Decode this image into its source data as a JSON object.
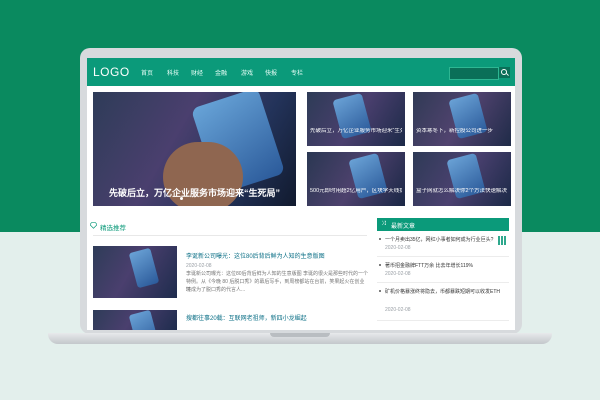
{
  "header": {
    "logo": "LOGO",
    "nav": [
      "首页",
      "科技",
      "财经",
      "金融",
      "游戏",
      "快报",
      "专栏"
    ]
  },
  "hero": {
    "title": "先破后立，万亿企业服务市场迎来“生死局”",
    "slide_count": 1
  },
  "cards": [
    {
      "title": "先破后立，万亿企业服务市场迎来“生死局”"
    },
    {
      "title": "资本寒冬下，新控股公司进一步"
    },
    {
      "title": "500元即时用超2亿用户，区块学天线提示问题"
    },
    {
      "title": "盒子网就怎么解决你2个方法快速解决"
    }
  ],
  "section": {
    "title": "精选推荐"
  },
  "articles": [
    {
      "title": "李诞新公司曝光：这位80后背后鲜为人知的生意版图",
      "date": "2020-02-08",
      "summary_line1": "李诞新公司曝光：这位80后背后鲜为人知的生意版图 李诞的很火是那些时代的一个",
      "summary_line2": "特例。从《今晚 80 后脱口秀》的幕后写手，到周榜都站在台前，笑果起火在创业环",
      "summary_line3": "境成为了脱口秀的代言人..."
    },
    {
      "title": "搜都往事20载：互联网老祖师，新四小龙崛起",
      "date": "",
      "summary_line1": "",
      "summary_line2": "",
      "summary_line3": ""
    }
  ],
  "sidebar": {
    "title": "最新文章",
    "items": [
      {
        "title": "一个月卖出35亿，网红小事者如何成为行业巨头?",
        "date": "2020-02-08"
      },
      {
        "title": "著币招金融牌FTT万余 比去年增长119%",
        "date": "2020-02-08"
      },
      {
        "title": "矿机价格暴涨终将隐去，币都暴跌短期可以收发ETH",
        "date": "2020-02-08"
      }
    ]
  },
  "colors": {
    "brand": "#0b9a7a",
    "background_top": "#0a8a5f",
    "background_bottom": "#e3efec"
  }
}
